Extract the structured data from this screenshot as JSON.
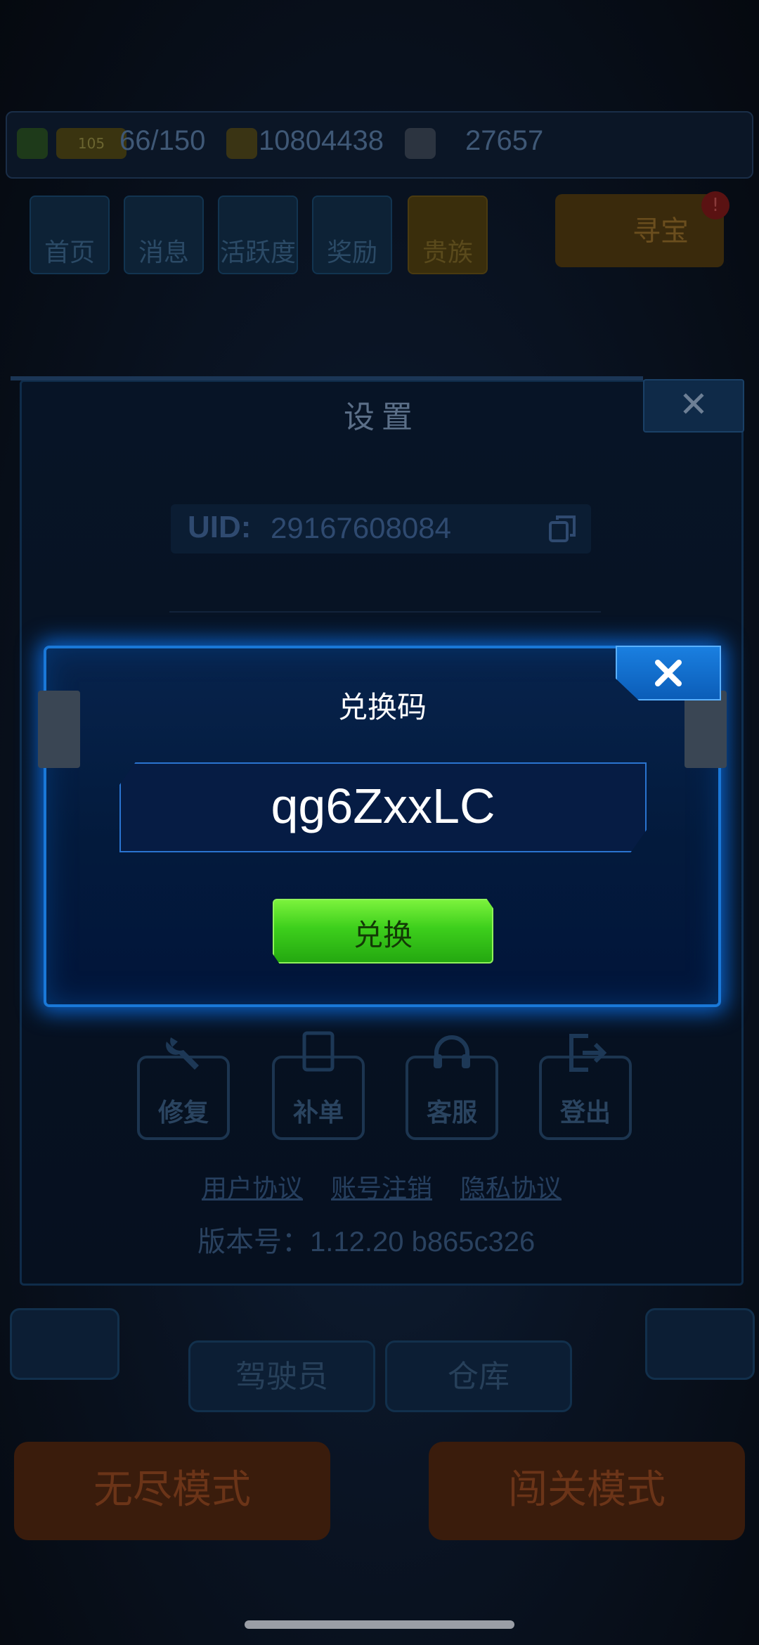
{
  "hud": {
    "energy": "66/150",
    "level_badge": "105",
    "coins": "10804438",
    "gems": "27657"
  },
  "nav": {
    "items": [
      {
        "label": "首页"
      },
      {
        "label": "消息"
      },
      {
        "label": "活跃度"
      },
      {
        "label": "奖励"
      },
      {
        "label": "贵族"
      }
    ],
    "treasure": "寻宝",
    "treasure_badge": "!"
  },
  "settings": {
    "title": "设置",
    "close": "✕",
    "uid_label": "UID:",
    "uid_value": "29167608084",
    "tools": [
      {
        "label": "修复"
      },
      {
        "label": "补单"
      },
      {
        "label": "客服"
      },
      {
        "label": "登出"
      }
    ],
    "links": [
      "用户协议",
      "账号注销",
      "隐私协议"
    ],
    "version": "版本号：1.12.20   b865c326"
  },
  "dialog": {
    "title": "兑换码",
    "code": "qg6ZxxLC",
    "redeem_label": "兑换"
  },
  "bottom": {
    "pilot": "驾驶员",
    "warehouse": "仓库",
    "endless_mode": "无尽模式",
    "stage_mode": "闯关模式"
  }
}
